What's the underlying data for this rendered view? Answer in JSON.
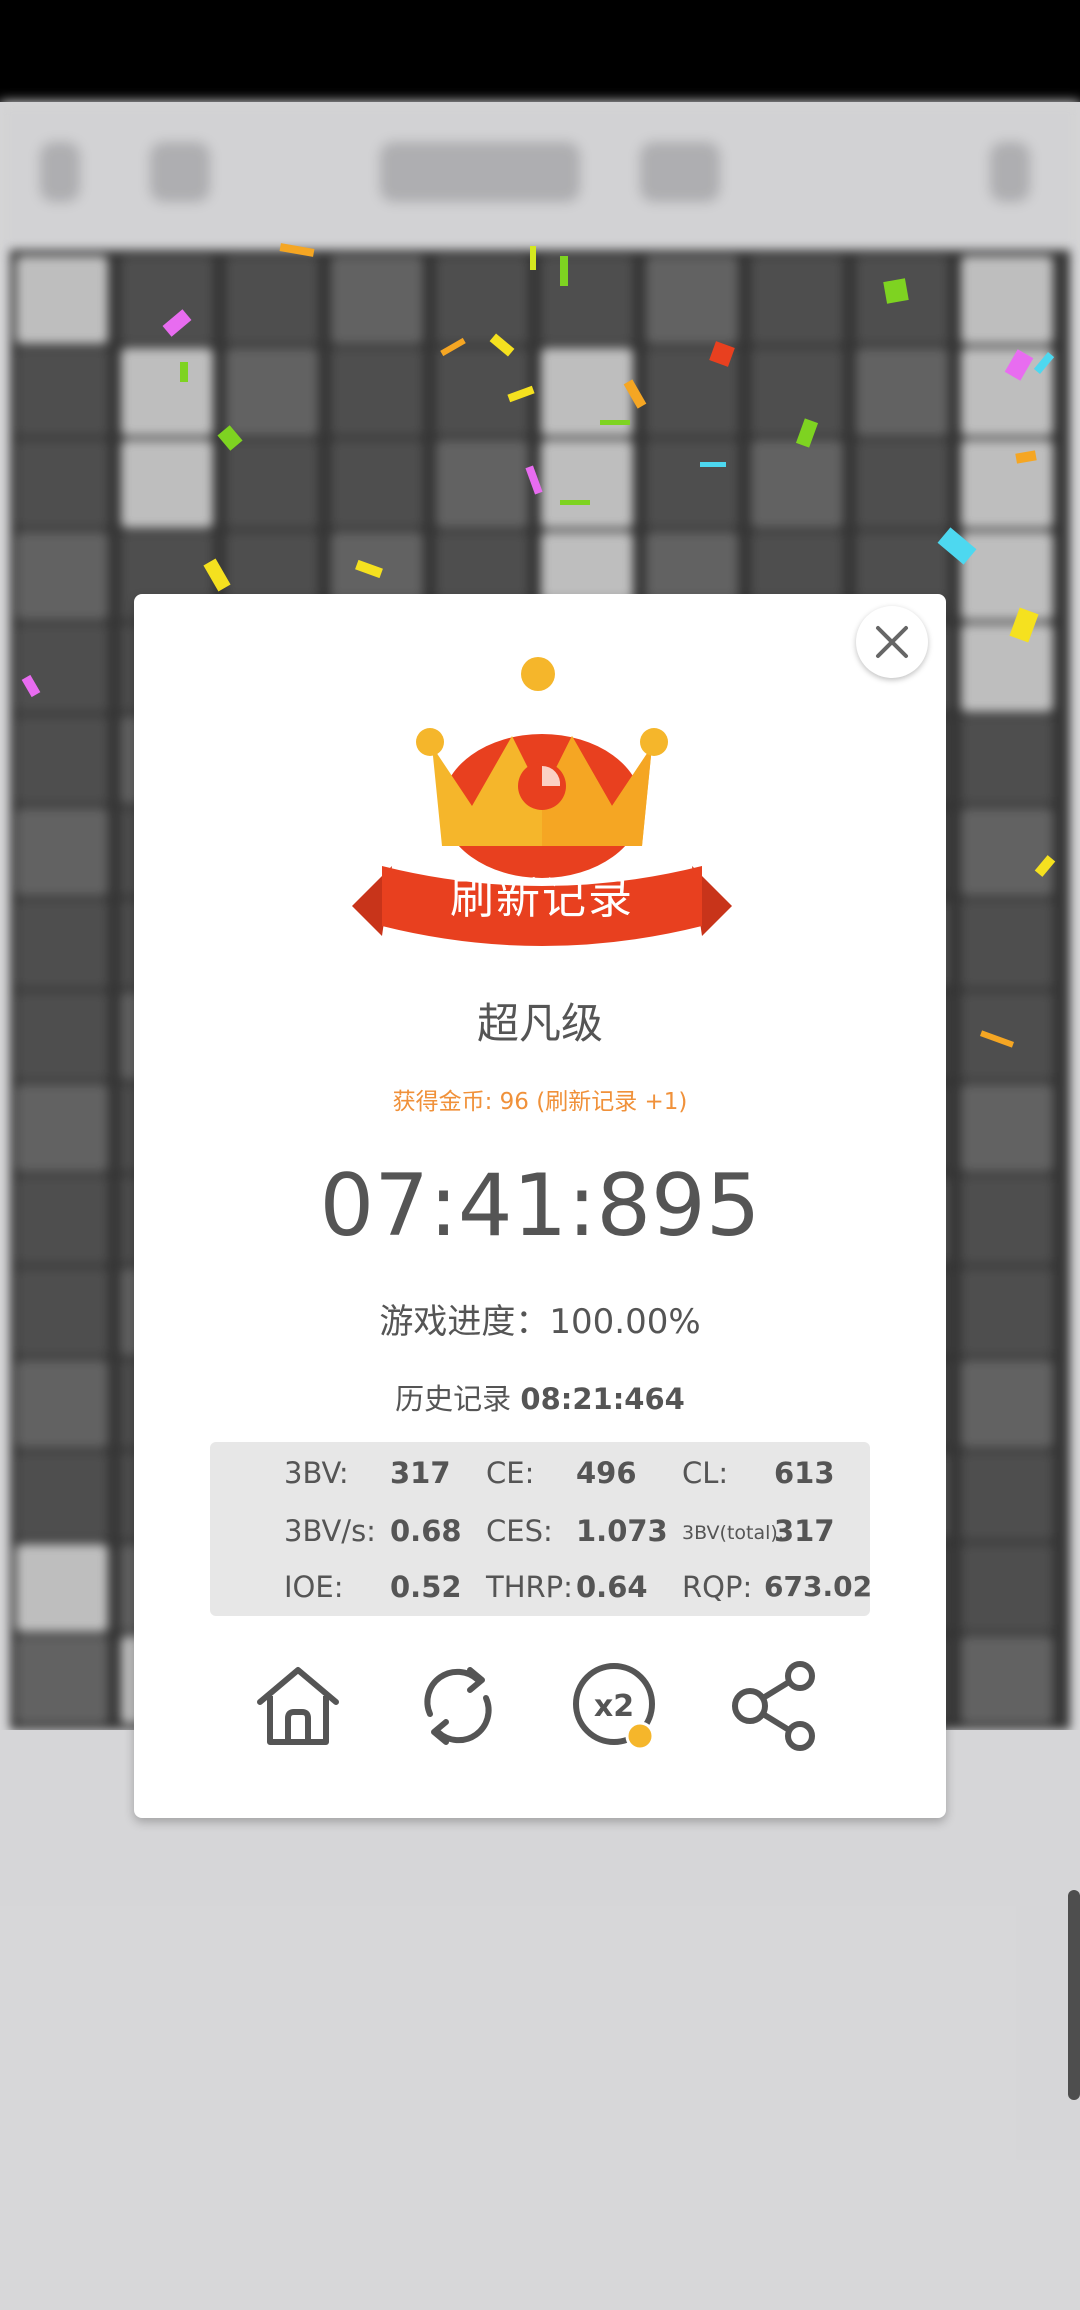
{
  "dialog": {
    "banner": "刷新记录",
    "level": "超凡级",
    "coins_text": "获得金币: 96 (刷新记录 +1)",
    "time": "07:41:895",
    "progress_label": "游戏进度：",
    "progress_value": "100.00%",
    "history_label": "历史记录",
    "history_value": "08:21:464",
    "stats": [
      {
        "label": "3BV:",
        "value": "317"
      },
      {
        "label": "CE:",
        "value": "496"
      },
      {
        "label": "CL:",
        "value": "613"
      },
      {
        "label": "3BV/s:",
        "value": "0.68"
      },
      {
        "label": "CES:",
        "value": "1.073"
      },
      {
        "label": "3BV(total):",
        "value": "317"
      },
      {
        "label": "IOE:",
        "value": "0.52"
      },
      {
        "label": "THRP:",
        "value": "0.64"
      },
      {
        "label": "RQP:",
        "value": "673.02"
      }
    ],
    "actions": [
      {
        "name": "home-icon"
      },
      {
        "name": "restart-icon"
      },
      {
        "name": "double-reward-icon",
        "badge": "x2"
      },
      {
        "name": "share-icon"
      }
    ]
  },
  "colors": {
    "accent_orange": "#f0913a",
    "banner_red": "#e8401f",
    "crown_yellow": "#f5b62b",
    "text_gray": "#555555"
  }
}
